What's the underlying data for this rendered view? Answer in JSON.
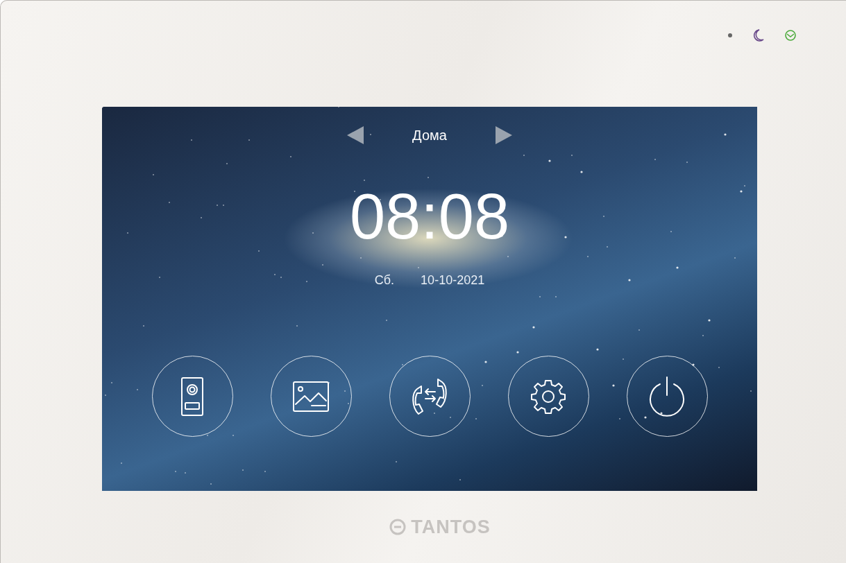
{
  "screen": {
    "location": "Дома",
    "time": "08:08",
    "day": "Сб.",
    "date": "10-10-2021",
    "buttons": [
      {
        "kind": "door-station"
      },
      {
        "kind": "gallery"
      },
      {
        "kind": "transfer"
      },
      {
        "kind": "settings"
      },
      {
        "kind": "power"
      }
    ]
  },
  "brand": "TANTOS"
}
